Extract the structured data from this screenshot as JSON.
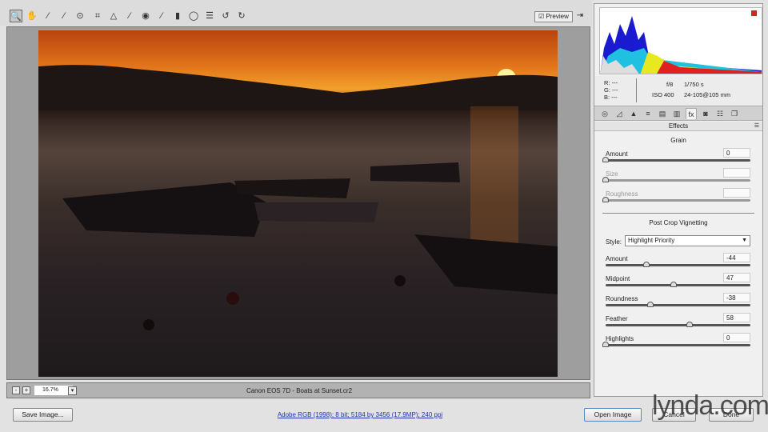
{
  "toolbar": {
    "tools": [
      {
        "name": "zoom-tool-icon",
        "glyph": "🔍"
      },
      {
        "name": "hand-tool-icon",
        "glyph": "✋"
      },
      {
        "name": "white-balance-tool-icon",
        "glyph": "⁄"
      },
      {
        "name": "color-sampler-tool-icon",
        "glyph": "⁄"
      },
      {
        "name": "targeted-adjustment-tool-icon",
        "glyph": "⊙"
      },
      {
        "name": "crop-tool-icon",
        "glyph": "⌗"
      },
      {
        "name": "straighten-tool-icon",
        "glyph": "△"
      },
      {
        "name": "spot-removal-tool-icon",
        "glyph": "⁄"
      },
      {
        "name": "red-eye-tool-icon",
        "glyph": "◉"
      },
      {
        "name": "adjustment-brush-icon",
        "glyph": "⁄"
      },
      {
        "name": "graduated-filter-icon",
        "glyph": "▮"
      },
      {
        "name": "radial-filter-icon",
        "glyph": "◯"
      },
      {
        "name": "preferences-icon",
        "glyph": "☰"
      },
      {
        "name": "rotate-left-icon",
        "glyph": "↺"
      },
      {
        "name": "rotate-right-icon",
        "glyph": "↻"
      }
    ],
    "preview_label": "Preview",
    "preview_checked": true
  },
  "status": {
    "zoom": "16.7%",
    "filename": "Canon EOS 7D  -  Boats at Sunset.cr2"
  },
  "info": {
    "r": "R:  ---",
    "g": "G:  ---",
    "b": "B:  ---",
    "aperture": "f/8",
    "shutter": "1/750 s",
    "iso": "ISO 400",
    "lens": "24-105@105 mm"
  },
  "panel": {
    "title": "Effects",
    "tabs": [
      "basic",
      "tone-curve",
      "detail",
      "hsl",
      "split-toning",
      "lens-corrections",
      "effects",
      "camera-calibration",
      "presets",
      "snapshots"
    ],
    "active_tab": 6,
    "grain": {
      "title": "Grain",
      "sliders": [
        {
          "label": "Amount",
          "value": "0",
          "fraction": 0,
          "disabled": false
        },
        {
          "label": "Size",
          "value": "",
          "fraction": 0,
          "disabled": true
        },
        {
          "label": "Roughness",
          "value": "",
          "fraction": 0,
          "disabled": true
        }
      ]
    },
    "vignette": {
      "title": "Post Crop Vignetting",
      "style_label": "Style:",
      "style_value": "Highlight Priority",
      "sliders": [
        {
          "label": "Amount",
          "value": "-44",
          "fraction": 0.28,
          "disabled": false
        },
        {
          "label": "Midpoint",
          "value": "47",
          "fraction": 0.47,
          "disabled": false
        },
        {
          "label": "Roundness",
          "value": "-38",
          "fraction": 0.31,
          "disabled": false
        },
        {
          "label": "Feather",
          "value": "58",
          "fraction": 0.58,
          "disabled": false
        },
        {
          "label": "Highlights",
          "value": "0",
          "fraction": 0,
          "disabled": false
        }
      ]
    }
  },
  "bottom": {
    "save": "Save Image...",
    "workflow": "Adobe RGB (1998); 8 bit; 5184 by 3456 (17.9MP); 240 ppi",
    "open": "Open Image",
    "cancel": "Cancel",
    "done": "Done"
  },
  "watermark": "lynda.com"
}
